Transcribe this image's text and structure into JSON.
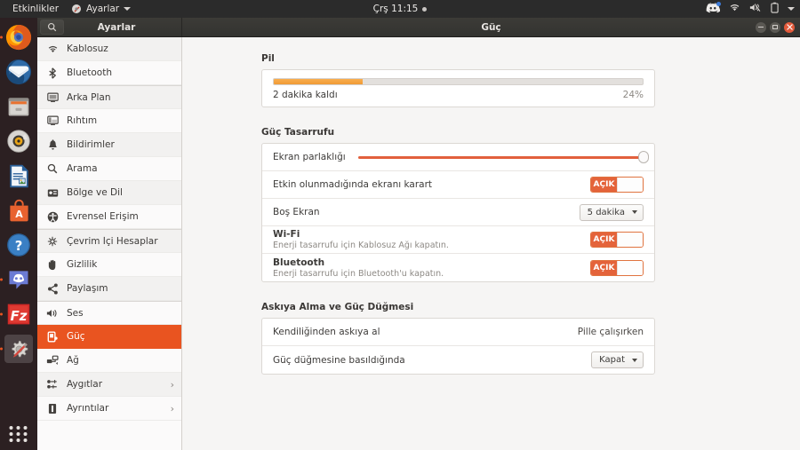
{
  "topbar": {
    "activities": "Etkinlikler",
    "app_menu": "Ayarlar",
    "app_icon": "settings-app-icon",
    "clock": "Çrş 11:15",
    "recording_dot": "status-dot",
    "tray": [
      {
        "name": "discord-tray-icon"
      },
      {
        "name": "wifi-icon"
      },
      {
        "name": "volume-muted-icon"
      },
      {
        "name": "battery-icon"
      },
      {
        "name": "chevron-down-icon"
      }
    ]
  },
  "dock": {
    "items": [
      {
        "name": "firefox",
        "running": true
      },
      {
        "name": "thunderbird",
        "running": false
      },
      {
        "name": "files",
        "running": false
      },
      {
        "name": "rhythmbox",
        "running": false
      },
      {
        "name": "libreoffice-writer",
        "running": false
      },
      {
        "name": "ubuntu-software",
        "running": false
      },
      {
        "name": "help",
        "running": false
      },
      {
        "name": "discord",
        "running": true
      },
      {
        "name": "filezilla",
        "running": true
      },
      {
        "name": "settings",
        "running": true,
        "active": true
      }
    ],
    "show_apps": "show-applications"
  },
  "window": {
    "sidebar_title": "Ayarlar",
    "main_title": "Güç",
    "search_icon": "search-icon",
    "buttons": {
      "minimize": "minimize-button",
      "maximize": "maximize-button",
      "close": "close-button"
    }
  },
  "sidebar": {
    "items": [
      {
        "label": "Kablosuz",
        "icon": "wifi-icon",
        "selected": false,
        "chevron": false,
        "group_start": false
      },
      {
        "label": "Bluetooth",
        "icon": "bluetooth-icon",
        "selected": false,
        "chevron": false,
        "group_start": false
      },
      {
        "label": "Arka Plan",
        "icon": "background-icon",
        "selected": false,
        "chevron": false,
        "group_start": true
      },
      {
        "label": "Rıhtım",
        "icon": "dock-icon",
        "selected": false,
        "chevron": false,
        "group_start": false
      },
      {
        "label": "Bildirimler",
        "icon": "bell-icon",
        "selected": false,
        "chevron": false,
        "group_start": false
      },
      {
        "label": "Arama",
        "icon": "search-icon",
        "selected": false,
        "chevron": false,
        "group_start": false
      },
      {
        "label": "Bölge ve Dil",
        "icon": "region-language-icon",
        "selected": false,
        "chevron": false,
        "group_start": false
      },
      {
        "label": "Evrensel Erişim",
        "icon": "accessibility-icon",
        "selected": false,
        "chevron": false,
        "group_start": false
      },
      {
        "label": "Çevrim İçi Hesaplar",
        "icon": "online-accounts-icon",
        "selected": false,
        "chevron": false,
        "group_start": true
      },
      {
        "label": "Gizlilik",
        "icon": "privacy-icon",
        "selected": false,
        "chevron": false,
        "group_start": false
      },
      {
        "label": "Paylaşım",
        "icon": "sharing-icon",
        "selected": false,
        "chevron": false,
        "group_start": false
      },
      {
        "label": "Ses",
        "icon": "sound-icon",
        "selected": false,
        "chevron": false,
        "group_start": true
      },
      {
        "label": "Güç",
        "icon": "power-icon",
        "selected": true,
        "chevron": false,
        "group_start": false
      },
      {
        "label": "Ağ",
        "icon": "network-icon",
        "selected": false,
        "chevron": false,
        "group_start": false
      },
      {
        "label": "Aygıtlar",
        "icon": "devices-icon",
        "selected": false,
        "chevron": true,
        "group_start": false
      },
      {
        "label": "Ayrıntılar",
        "icon": "details-icon",
        "selected": false,
        "chevron": true,
        "group_start": false
      }
    ]
  },
  "main": {
    "battery": {
      "section_title": "Pil",
      "time_remaining": "2 dakika kaldı",
      "percent_label": "24%",
      "percent_value": 24
    },
    "power_saving": {
      "section_title": "Güç Tasarrufu",
      "brightness": {
        "label": "Ekran parlaklığı",
        "value": 100
      },
      "dim_screen": {
        "label": "Etkin olunmadığında ekranı karart",
        "toggle_label": "AÇIK",
        "on": true
      },
      "blank_screen": {
        "label": "Boş Ekran",
        "value": "5 dakika"
      },
      "wifi": {
        "label": "Wi-Fi",
        "sub": "Enerji tasarrufu için Kablosuz Ağı kapatın.",
        "toggle_label": "AÇIK",
        "on": true
      },
      "bluetooth": {
        "label": "Bluetooth",
        "sub": "Enerji tasarrufu için Bluetooth'u kapatın.",
        "toggle_label": "AÇIK",
        "on": true
      }
    },
    "suspend": {
      "section_title": "Askıya Alma ve Güç Düğmesi",
      "auto_suspend": {
        "label": "Kendiliğinden askıya al",
        "value": "Pille çalışırken"
      },
      "power_button": {
        "label": "Güç düğmesine basıldığında",
        "value": "Kapat"
      }
    }
  },
  "colors": {
    "accent": "#e95420",
    "toggle_on": "#e4633a",
    "battery_fill": "#f09a36",
    "slider": "#e2603d",
    "topbar": "#2b2b2b"
  }
}
